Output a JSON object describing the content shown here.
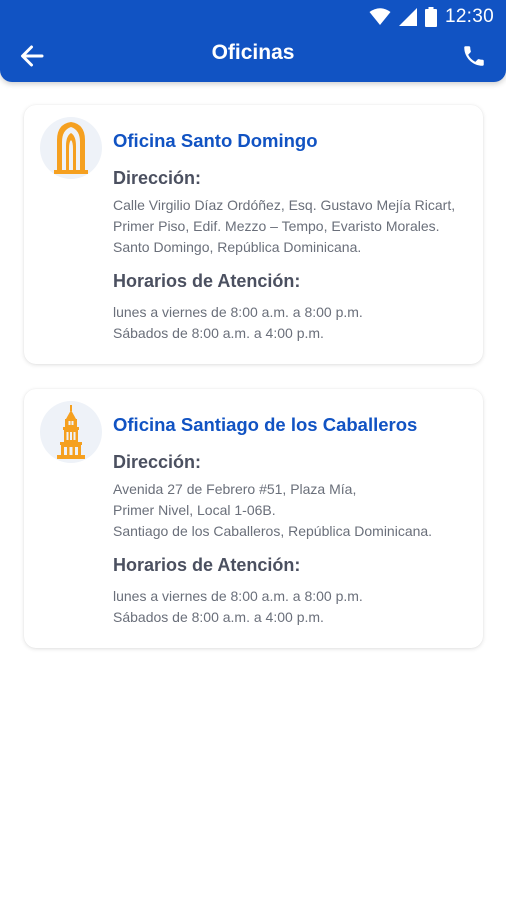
{
  "status_bar": {
    "time": "12:30"
  },
  "header": {
    "title": "Oficinas",
    "back_icon": "arrow-left-icon",
    "phone_icon": "phone-icon"
  },
  "offices": [
    {
      "name": "Oficina Santo Domingo",
      "icon": "cathedral-arch-icon",
      "address_heading": "Dirección:",
      "address_lines": [
        "Calle Virgilio Díaz Ordóñez, Esq. Gustavo Mejía Ricart,",
        "Primer Piso, Edif. Mezzo – Tempo, Evaristo Morales.",
        "Santo Domingo, República  Dominicana."
      ],
      "hours_heading": "Horarios de Atención:",
      "hours_lines": [
        "lunes a viernes de 8:00 a.m. a 8:00 p.m.",
        "Sábados de 8:00 a.m. a 4:00 p.m."
      ]
    },
    {
      "name": "Oficina Santiago de los Caballeros",
      "icon": "monument-icon",
      "address_heading": "Dirección:",
      "address_lines": [
        "Avenida 27 de Febrero #51, Plaza Mía,",
        "Primer Nivel, Local 1-06B.",
        "Santiago de los Caballeros, República Dominicana."
      ],
      "hours_heading": "Horarios de Atención:",
      "hours_lines": [
        "lunes a viernes de 8:00 a.m. a 8:00 p.m.",
        "Sábados de 8:00 a.m. a 4:00 p.m."
      ]
    }
  ],
  "colors": {
    "primary": "#1153c3",
    "accent_orange": "#f5a020",
    "heading_gray": "#4b5060",
    "body_gray": "#6a6f7a"
  }
}
